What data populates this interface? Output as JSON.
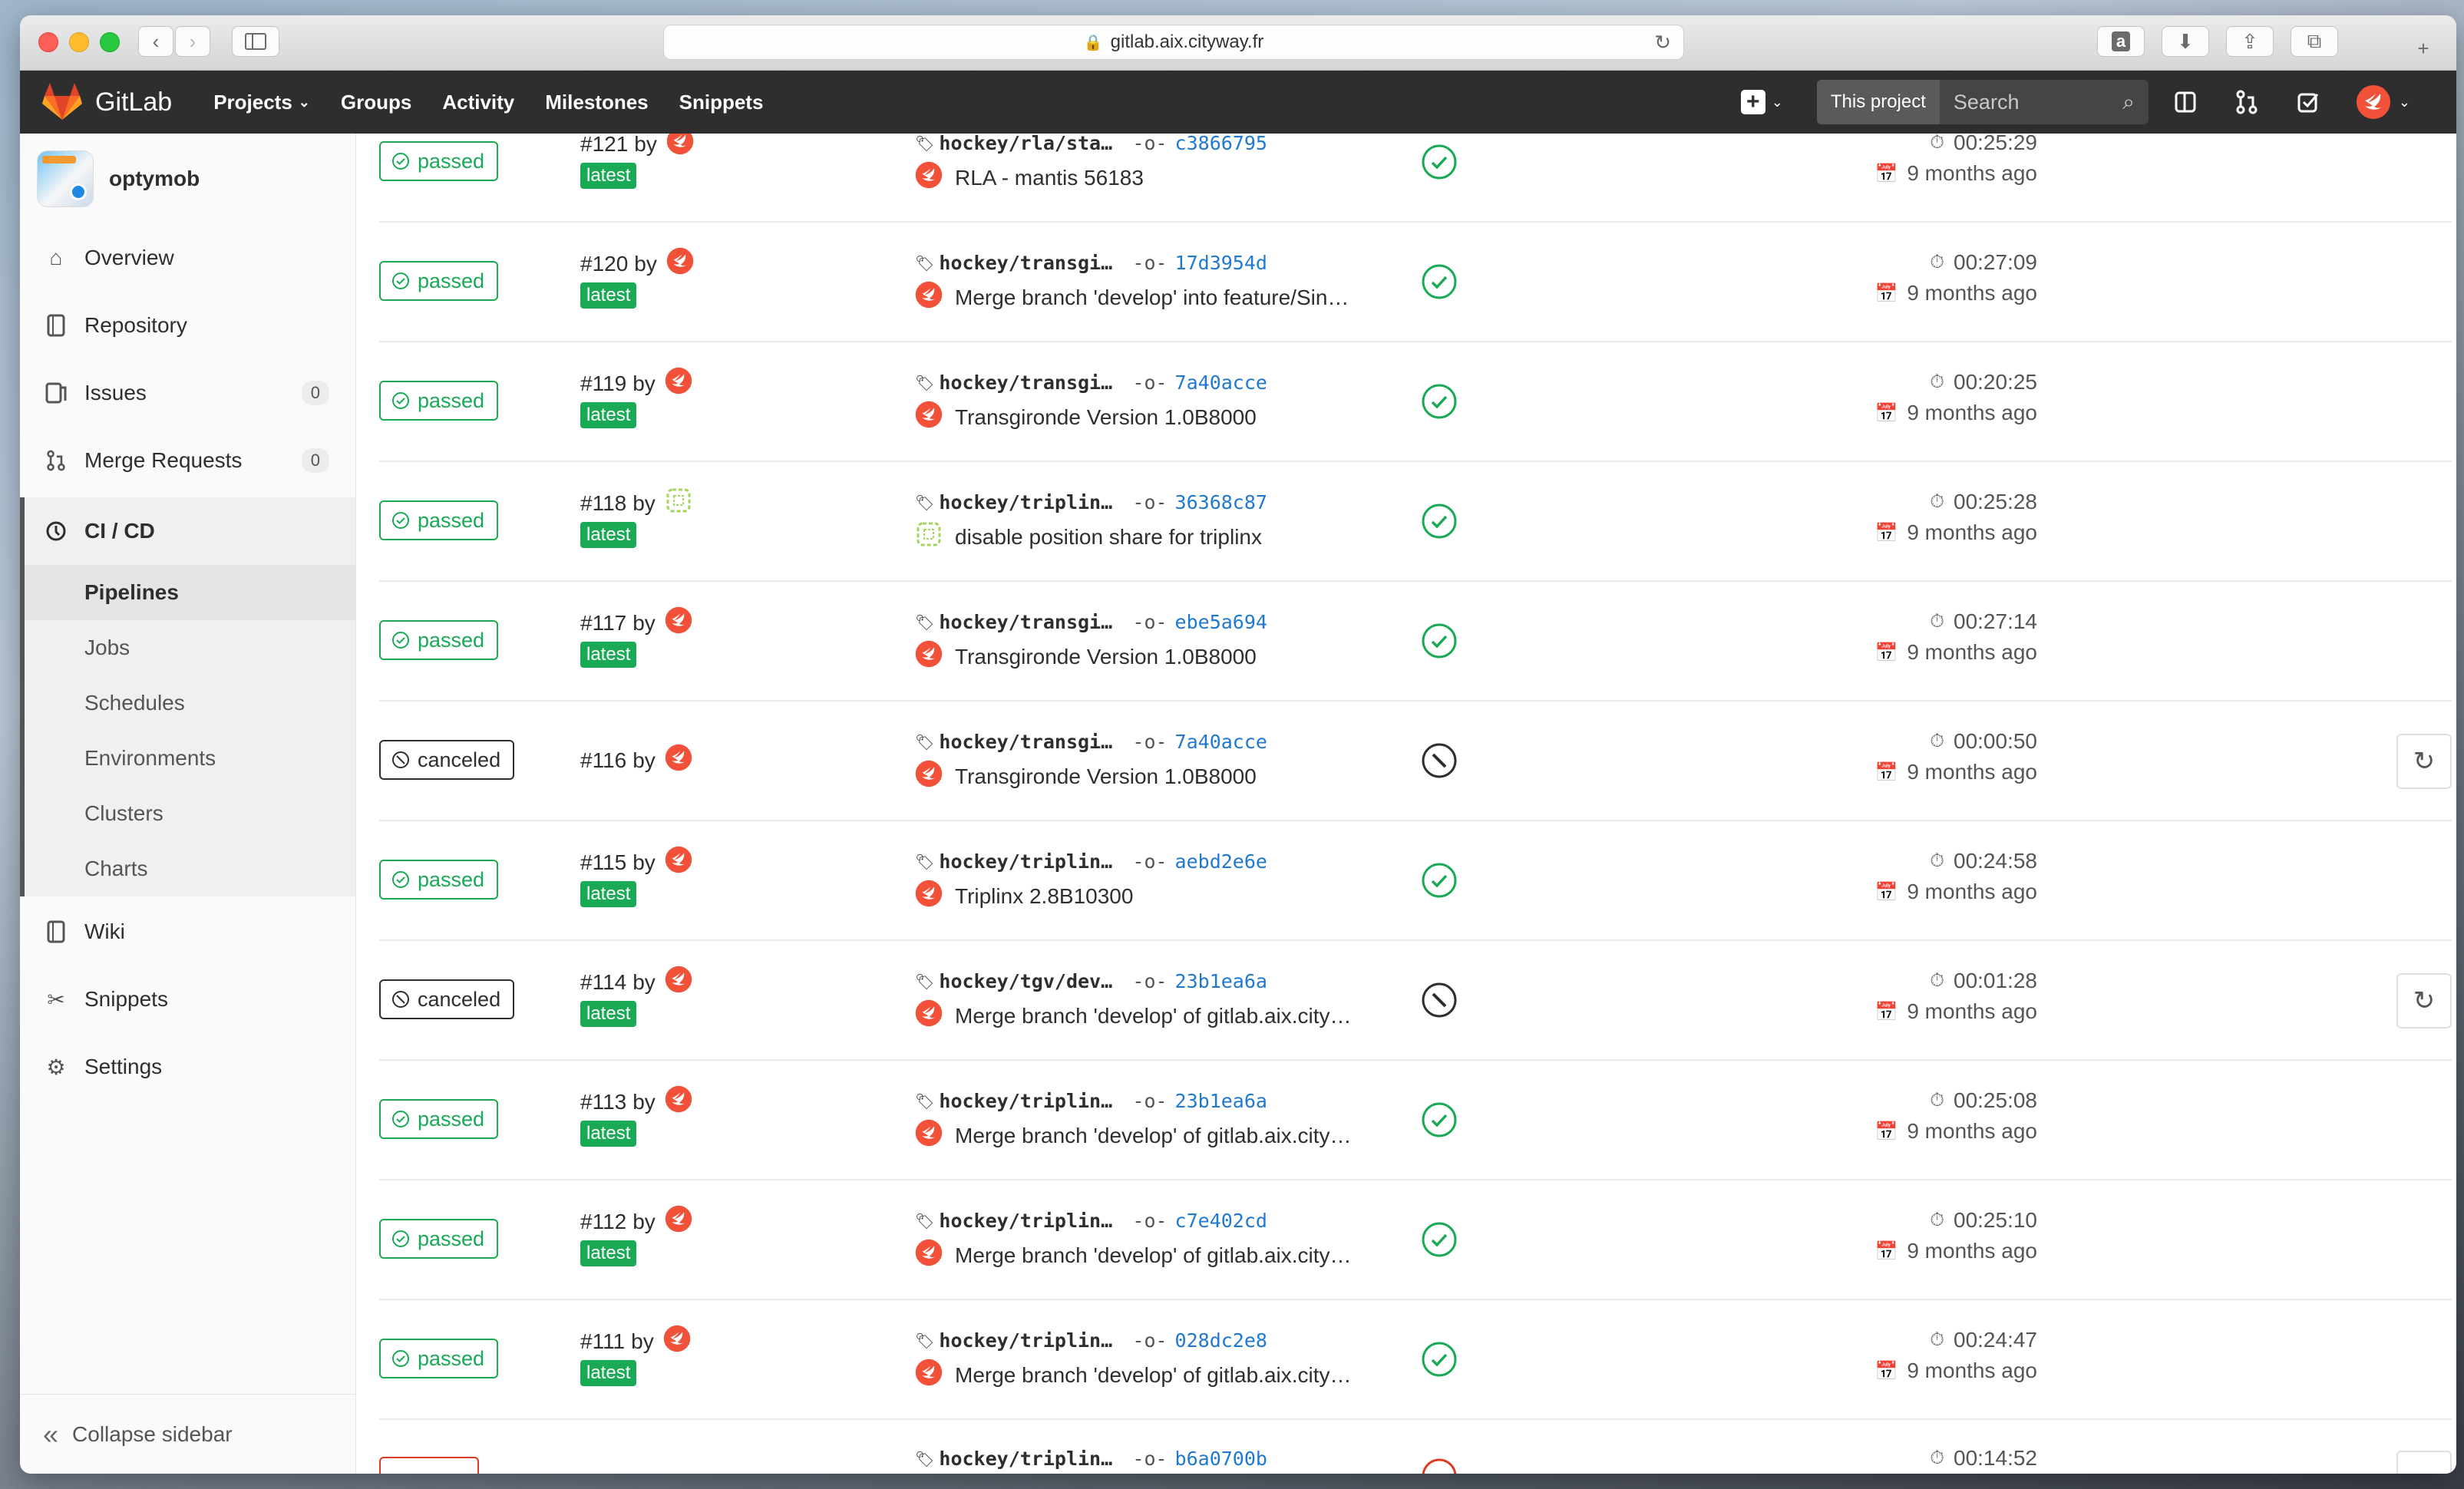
{
  "browser": {
    "url": "gitlab.aix.cityway.fr"
  },
  "header": {
    "brand": "GitLab",
    "nav": [
      {
        "label": "Projects"
      },
      {
        "label": "Groups"
      },
      {
        "label": "Activity"
      },
      {
        "label": "Milestones"
      },
      {
        "label": "Snippets"
      }
    ],
    "search_scope": "This project",
    "search_placeholder": "Search"
  },
  "sidebar": {
    "project_name": "optymob",
    "items": [
      {
        "label": "Overview",
        "icon": "home-icon"
      },
      {
        "label": "Repository",
        "icon": "book-icon"
      },
      {
        "label": "Issues",
        "icon": "issues-icon",
        "count": "0"
      },
      {
        "label": "Merge Requests",
        "icon": "merge-request-icon",
        "count": "0"
      }
    ],
    "cicd": {
      "label": "CI / CD",
      "subitems": [
        "Pipelines",
        "Jobs",
        "Schedules",
        "Environments",
        "Clusters",
        "Charts"
      ]
    },
    "items_after": [
      {
        "label": "Wiki",
        "icon": "book-icon"
      },
      {
        "label": "Snippets",
        "icon": "scissors-icon"
      },
      {
        "label": "Settings",
        "icon": "gear-icon"
      }
    ],
    "collapse_label": "Collapse sidebar"
  },
  "pipelines": [
    {
      "status": "passed",
      "id": "#121",
      "by": "by",
      "latest": "latest",
      "ref": "hockey/rla/sta…",
      "sha": "c3866795",
      "commit": "RLA - mantis 56183",
      "stage": "passed",
      "duration": "00:25:29",
      "finished": "9 months ago",
      "retry": false,
      "avatar": "swift"
    },
    {
      "status": "passed",
      "id": "#120",
      "by": "by",
      "latest": "latest",
      "ref": "hockey/transgi…",
      "sha": "17d3954d",
      "commit": "Merge branch 'develop' into feature/Sin…",
      "stage": "passed",
      "duration": "00:27:09",
      "finished": "9 months ago",
      "retry": false,
      "avatar": "swift"
    },
    {
      "status": "passed",
      "id": "#119",
      "by": "by",
      "latest": "latest",
      "ref": "hockey/transgi…",
      "sha": "7a40acce",
      "commit": "Transgironde Version 1.0B8000",
      "stage": "passed",
      "duration": "00:20:25",
      "finished": "9 months ago",
      "retry": false,
      "avatar": "swift"
    },
    {
      "status": "passed",
      "id": "#118",
      "by": "by",
      "latest": "latest",
      "ref": "hockey/triplin…",
      "sha": "36368c87",
      "commit": "disable position share for triplinx",
      "stage": "passed",
      "duration": "00:25:28",
      "finished": "9 months ago",
      "retry": false,
      "avatar": "identicon"
    },
    {
      "status": "passed",
      "id": "#117",
      "by": "by",
      "latest": "latest",
      "ref": "hockey/transgi…",
      "sha": "ebe5a694",
      "commit": "Transgironde Version 1.0B8000",
      "stage": "passed",
      "duration": "00:27:14",
      "finished": "9 months ago",
      "retry": false,
      "avatar": "swift"
    },
    {
      "status": "canceled",
      "id": "#116",
      "by": "by",
      "latest": "",
      "ref": "hockey/transgi…",
      "sha": "7a40acce",
      "commit": "Transgironde Version 1.0B8000",
      "stage": "canceled",
      "duration": "00:00:50",
      "finished": "9 months ago",
      "retry": true,
      "avatar": "swift"
    },
    {
      "status": "passed",
      "id": "#115",
      "by": "by",
      "latest": "latest",
      "ref": "hockey/triplin…",
      "sha": "aebd2e6e",
      "commit": "Triplinx 2.8B10300",
      "stage": "passed",
      "duration": "00:24:58",
      "finished": "9 months ago",
      "retry": false,
      "avatar": "swift"
    },
    {
      "status": "canceled",
      "id": "#114",
      "by": "by",
      "latest": "latest",
      "ref": "hockey/tgv/dev…",
      "sha": "23b1ea6a",
      "commit": "Merge branch 'develop' of gitlab.aix.city…",
      "stage": "canceled",
      "duration": "00:01:28",
      "finished": "9 months ago",
      "retry": true,
      "avatar": "swift"
    },
    {
      "status": "passed",
      "id": "#113",
      "by": "by",
      "latest": "latest",
      "ref": "hockey/triplin…",
      "sha": "23b1ea6a",
      "commit": "Merge branch 'develop' of gitlab.aix.city…",
      "stage": "passed",
      "duration": "00:25:08",
      "finished": "9 months ago",
      "retry": false,
      "avatar": "swift"
    },
    {
      "status": "passed",
      "id": "#112",
      "by": "by",
      "latest": "latest",
      "ref": "hockey/triplin…",
      "sha": "c7e402cd",
      "commit": "Merge branch 'develop' of gitlab.aix.city…",
      "stage": "passed",
      "duration": "00:25:10",
      "finished": "9 months ago",
      "retry": false,
      "avatar": "swift"
    },
    {
      "status": "passed",
      "id": "#111",
      "by": "by",
      "latest": "latest",
      "ref": "hockey/triplin…",
      "sha": "028dc2e8",
      "commit": "Merge branch 'develop' of gitlab.aix.city…",
      "stage": "passed",
      "duration": "00:24:47",
      "finished": "9 months ago",
      "retry": false,
      "avatar": "swift"
    }
  ],
  "partial_row": {
    "ref": "hockey/triplin…",
    "sha": "b6a0700b",
    "duration": "00:14:52"
  },
  "colors": {
    "passed": "#1aaa55",
    "canceled": "#2e2e2e",
    "failed": "#db3b21",
    "link": "#1f78d1",
    "header_bg": "#2e2e2e"
  }
}
